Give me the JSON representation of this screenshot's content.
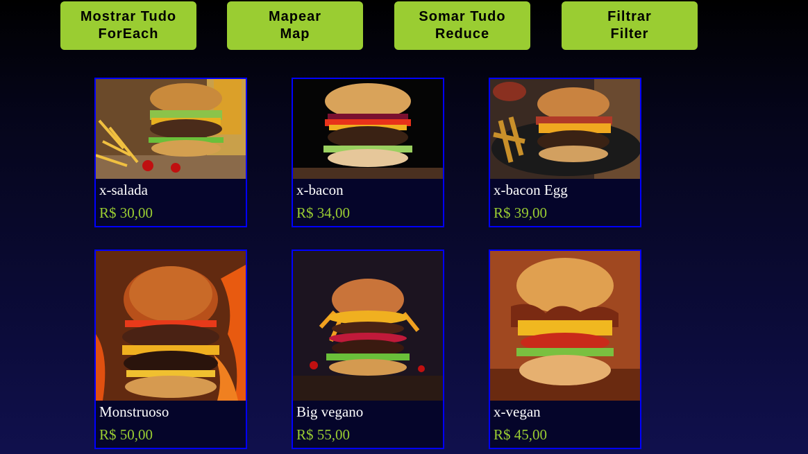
{
  "buttons": [
    {
      "line1": "Mostrar Tudo",
      "line2": "ForEach"
    },
    {
      "line1": "Mapear",
      "line2": "Map"
    },
    {
      "line1": "Somar Tudo",
      "line2": "Reduce"
    },
    {
      "line1": "Filtrar",
      "line2": "Filter"
    }
  ],
  "products": [
    {
      "name": "x-salada",
      "price": "R$ 30,00",
      "image": "burger-salad-photo"
    },
    {
      "name": "x-bacon",
      "price": "R$ 34,00",
      "image": "burger-bacon-photo"
    },
    {
      "name": "x-bacon Egg",
      "price": "R$ 39,00",
      "image": "burger-bacon-egg-photo"
    },
    {
      "name": "Monstruoso",
      "price": "R$ 50,00",
      "image": "burger-monster-photo"
    },
    {
      "name": "Big vegano",
      "price": "R$ 55,00",
      "image": "burger-big-vegan-photo"
    },
    {
      "name": "x-vegan",
      "price": "R$ 45,00",
      "image": "burger-vegan-photo"
    }
  ],
  "colors": {
    "button_bg": "#9acd32",
    "price_text": "#9acd32",
    "card_border": "#0000ff",
    "name_text": "#ffffff"
  }
}
